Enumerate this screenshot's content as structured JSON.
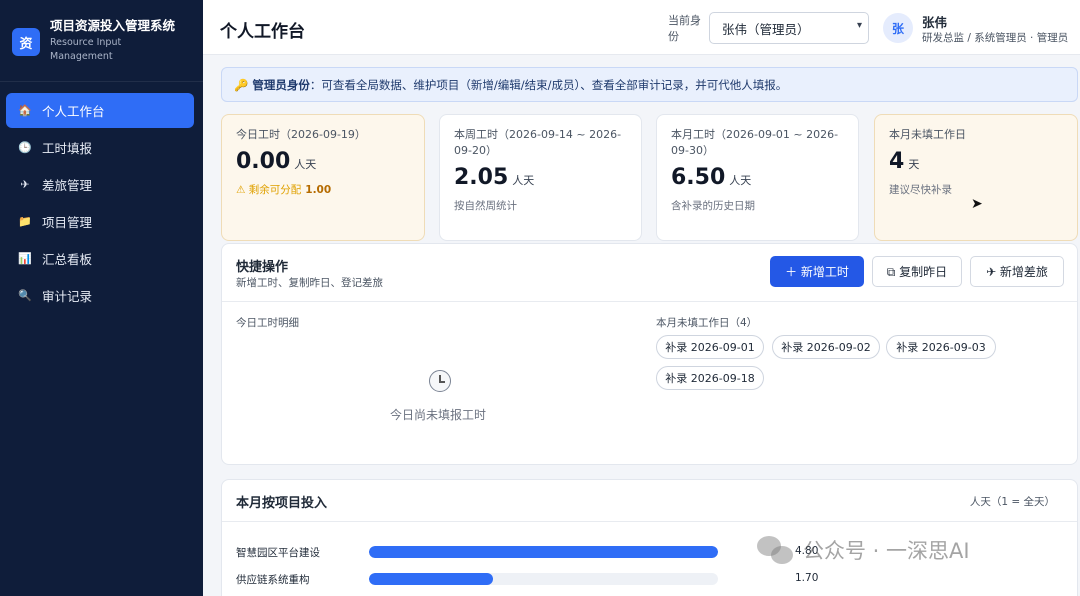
{
  "brand": {
    "logo": "资",
    "title": "项目资源投入管理系统",
    "subtitle": "Resource Input Management"
  },
  "sidebar": {
    "items": [
      {
        "label": "个人工作台",
        "icon": "home-icon",
        "glyph": "🏠",
        "active": true
      },
      {
        "label": "工时填报",
        "icon": "clock-icon",
        "glyph": "🕒"
      },
      {
        "label": "差旅管理",
        "icon": "plane-icon",
        "glyph": "✈"
      },
      {
        "label": "项目管理",
        "icon": "folder-icon",
        "glyph": "📁"
      },
      {
        "label": "汇总看板",
        "icon": "chart-icon",
        "glyph": "📊"
      },
      {
        "label": "审计记录",
        "icon": "search-icon",
        "glyph": "🔍"
      }
    ]
  },
  "header": {
    "title": "个人工作台",
    "role_label": "当前身份",
    "role_value": "张伟（管理员）",
    "avatar": "张",
    "user_name": "张伟",
    "user_role": "研发总监 / 系统管理员 · 管理员"
  },
  "notice": {
    "icon": "🔑",
    "bold": "管理员身份",
    "text": "：可查看全局数据、维护项目（新增/编辑/结束/成员）、查看全部审计记录，并可代他人填报。"
  },
  "stats": [
    {
      "label": "今日工时（2026-09-19）",
      "value": "0.00",
      "unit": "人天",
      "note_prefix": "⚠ 剩余可分配",
      "note_value": "1.00"
    },
    {
      "label": "本周工时（2026-09-14 ~ 2026-09-20）",
      "value": "2.05",
      "unit": "人天",
      "note": "按自然周统计"
    },
    {
      "label": "本月工时（2026-09-01 ~ 2026-09-30）",
      "value": "6.50",
      "unit": "人天",
      "note": "含补录的历史日期"
    },
    {
      "label": "本月未填工作日",
      "value": "4",
      "unit": "天",
      "note": "建议尽快补录"
    }
  ],
  "quick": {
    "title": "快捷操作",
    "subtitle": "新增工时、复制昨日、登记差旅",
    "btn_add": "＋ 新增工时",
    "btn_copy": "⧉ 复制昨日",
    "btn_trip": "✈ 新增差旅",
    "today_label": "今日工时明细",
    "empty_text": "今日尚未填报工时",
    "missing_label": "本月未填工作日（4）",
    "chips": [
      "补录 2026-09-01",
      "补录 2026-09-02",
      "补录 2026-09-03",
      "补录 2026-09-18"
    ]
  },
  "projects": {
    "title": "本月按项目投入",
    "unit": "人天（1 = 全天）",
    "items": [
      {
        "name": "智慧园区平台建设",
        "value": "4.80",
        "ratio": 1.0
      },
      {
        "name": "供应链系统重构",
        "value": "1.70",
        "ratio": 0.354
      }
    ]
  },
  "watermark": "公众号 · 一深思AI",
  "colors": {
    "accent": "#2f6df6",
    "sidebar": "#0f1d3a",
    "warning": "#e0a100"
  }
}
